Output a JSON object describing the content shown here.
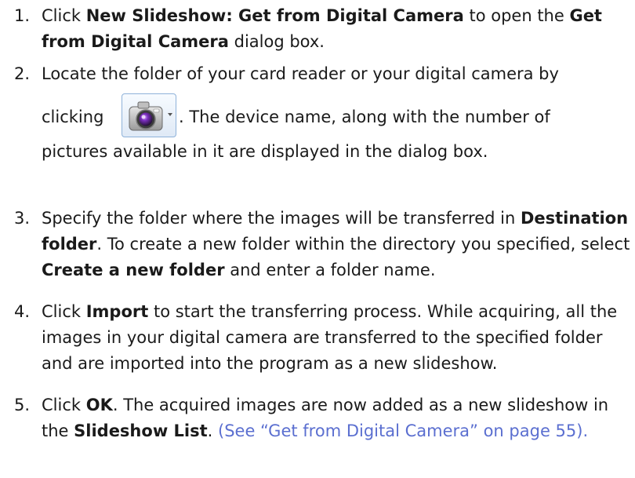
{
  "steps": [
    {
      "number": "1.",
      "t1": "Click ",
      "b1": "New Slideshow: Get from Digital Camera",
      "t2": " to open the ",
      "b2": "Get from Digital Camera",
      "t3": " dialog box."
    },
    {
      "number": "2.",
      "t1": "Locate the folder of your card reader or your digital camera by",
      "pre_icon": "clicking",
      "icon": "camera-icon",
      "post_icon": ". The device name, along with the number of",
      "t2": "pictures available in it are displayed in the dialog box."
    },
    {
      "number": "3.",
      "t1": "Specify the folder where the images will be transferred in ",
      "b1": "Destination folder",
      "t2": ". To create a new folder within the directory you specified, select ",
      "b2": "Create a new folder",
      "t3": " and enter a folder name."
    },
    {
      "number": "4.",
      "t1": "Click ",
      "b1": "Import",
      "t2": " to start the transferring process. While acquiring, all the images in your digital camera are transferred to the specified folder and are imported into the program as a new slideshow."
    },
    {
      "number": "5.",
      "t1": "Click ",
      "b1": "OK",
      "t2": ". The acquired images are now added as a new slideshow in the ",
      "b2": "Slideshow List",
      "t3": ". ",
      "link": "(See “Get from Digital Camera” on page 55)."
    }
  ],
  "colors": {
    "link": "#5b6fd0",
    "text": "#1a1a1a",
    "button_border": "#8fb2d9"
  }
}
